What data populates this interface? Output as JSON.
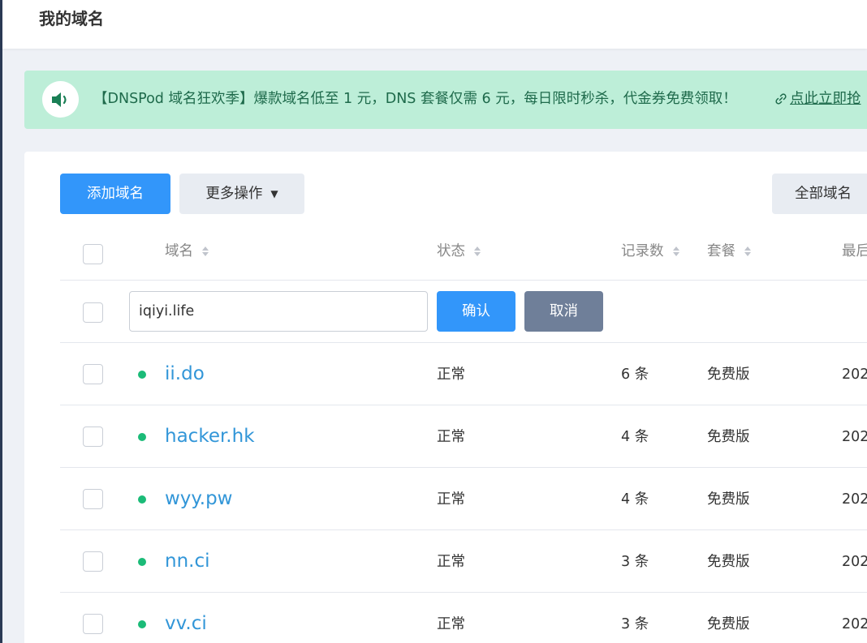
{
  "header": {
    "title": "我的域名"
  },
  "notice": {
    "icon": "speaker-icon",
    "text": "【DNSPod 域名狂欢季】爆款域名低至 1 元，DNS 套餐仅需 6 元，每日限时秒杀，代金券免费领取！",
    "link_icon": "link-icon",
    "link_label": "点此立即抢"
  },
  "toolbar": {
    "add_label": "添加域名",
    "more_label": "更多操作",
    "filter_label": "全部域名"
  },
  "table": {
    "headers": {
      "domain": "域名",
      "status": "状态",
      "records": "记录数",
      "plan": "套餐",
      "last": "最后"
    },
    "add_row": {
      "input_value": "iqiyi.life",
      "confirm_label": "确认",
      "cancel_label": "取消"
    },
    "rows": [
      {
        "domain": "ii.do",
        "status": "正常",
        "records": "6 条",
        "plan": "免费版",
        "date": "202"
      },
      {
        "domain": "hacker.hk",
        "status": "正常",
        "records": "4 条",
        "plan": "免费版",
        "date": "202"
      },
      {
        "domain": "wyy.pw",
        "status": "正常",
        "records": "4 条",
        "plan": "免费版",
        "date": "202"
      },
      {
        "domain": "nn.ci",
        "status": "正常",
        "records": "3 条",
        "plan": "免费版",
        "date": "202"
      },
      {
        "domain": "vv.ci",
        "status": "正常",
        "records": "3 条",
        "plan": "免费版",
        "date": "202"
      }
    ]
  },
  "colors": {
    "primary": "#3296fa",
    "notice_bg": "#bdeed8",
    "notice_text": "#1e6a4b",
    "status_dot": "#1bbb78",
    "domain_link": "#3296d8",
    "cancel_button": "#6f7f99"
  }
}
